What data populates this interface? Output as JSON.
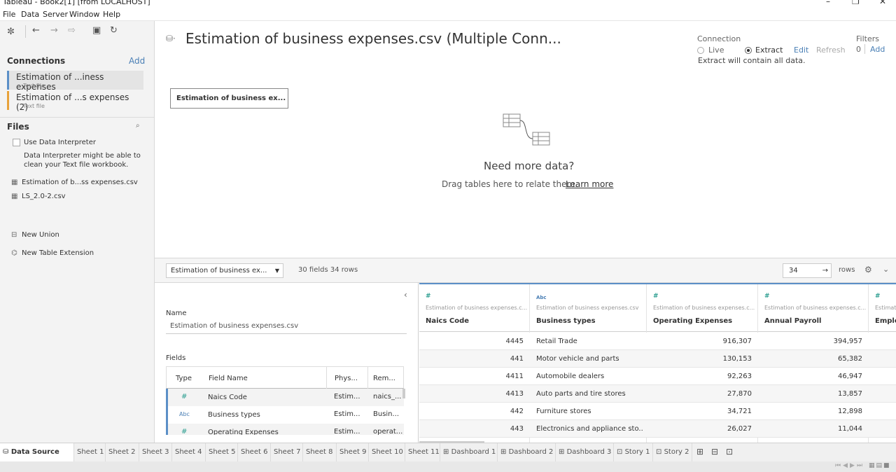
{
  "window": {
    "title": "Tableau - Book2[1] [from LOCALHOST]"
  },
  "menu": [
    "File",
    "Data",
    "Server",
    "Window",
    "Help"
  ],
  "connections": {
    "title": "Connections",
    "add_label": "Add",
    "items": [
      {
        "name": "Estimation of ...iness expenses",
        "type": "Text file"
      },
      {
        "name": "Estimation of ...s expenses (2)",
        "type": "Text file"
      }
    ]
  },
  "files": {
    "title": "Files",
    "use_interpreter": "Use Data Interpreter",
    "interpreter_note_1": "Data Interpreter might be able to",
    "interpreter_note_2": "clean your Text file workbook.",
    "items": [
      "Estimation of b...ss expenses.csv",
      "LS_2.0-2.csv"
    ],
    "new_union": "New Union",
    "new_table_extension": "New Table Extension"
  },
  "canvas": {
    "title": "Estimation of business expenses.csv (Multiple Conn...",
    "table_box": "Estimation of business ex...",
    "need_more": "Need more data?",
    "drag_hint": "Drag tables here to relate them.",
    "learn_more": "Learn more"
  },
  "connection_settings": {
    "label": "Connection",
    "live": "Live",
    "extract": "Extract",
    "edit": "Edit",
    "refresh": "Refresh",
    "extract_note": "Extract will contain all data.",
    "filters_label": "Filters",
    "filters_count": "0",
    "filters_add": "Add"
  },
  "grid_toolbar": {
    "table_select": "Estimation of business ex...",
    "fields_rows": "30 fields 34 rows",
    "rows_value": "34",
    "rows_label": "rows"
  },
  "metadata": {
    "name_label": "Name",
    "name_value": "Estimation of business expenses.csv",
    "fields_label": "Fields",
    "headers": [
      "Type",
      "Field Name",
      "Phys...",
      "Rem..."
    ],
    "rows": [
      {
        "type": "#",
        "name": "Naics Code",
        "phys": "Estim...",
        "rem": "naics_..."
      },
      {
        "type": "Abc",
        "name": "Business types",
        "phys": "Estim...",
        "rem": "Busin..."
      },
      {
        "type": "#",
        "name": "Operating Expenses",
        "phys": "Estim...",
        "rem": "operat..."
      }
    ]
  },
  "grid": {
    "columns": [
      {
        "type": "#",
        "source": "Estimation of business expenses.c...",
        "name": "Naics Code",
        "align": "right"
      },
      {
        "type": "Abc",
        "source": "Estimation of business expenses.csv",
        "name": "Business types",
        "align": "left"
      },
      {
        "type": "#",
        "source": "Estimation of business expenses.c...",
        "name": "Operating Expenses",
        "align": "right"
      },
      {
        "type": "#",
        "source": "Estimation of business expenses.c...",
        "name": "Annual Payroll",
        "align": "right"
      },
      {
        "type": "#",
        "source": "Estimati",
        "name": "Emplo",
        "align": "left"
      }
    ],
    "rows": [
      [
        "4445",
        "Retail Trade",
        "916,307",
        "394,957"
      ],
      [
        "441",
        "Motor vehicle and parts",
        "130,153",
        "65,382"
      ],
      [
        "4411",
        "Automobile dealers",
        "92,263",
        "46,947"
      ],
      [
        "4413",
        "Auto parts and tire stores",
        "27,870",
        "13,857"
      ],
      [
        "442",
        "Furniture stores",
        "34,721",
        "12,898"
      ],
      [
        "443",
        "Electronics and appliance sto...",
        "26,027",
        "11,044"
      ]
    ]
  },
  "tabs": [
    "Data Source",
    "Sheet 1",
    "Sheet 2",
    "Sheet 3",
    "Sheet 4",
    "Sheet 5",
    "Sheet 6",
    "Sheet 7",
    "Sheet 8",
    "Sheet 9",
    "Sheet 10",
    "Sheet 11",
    "Dashboard 1",
    "Dashboard 2",
    "Dashboard 3",
    "Story 1",
    "Story 2"
  ],
  "colors": {
    "accent": "#4a7fb5",
    "teal": "#2a9d8f",
    "conn1": "#5b8fc7",
    "conn2": "#e8a23a"
  }
}
